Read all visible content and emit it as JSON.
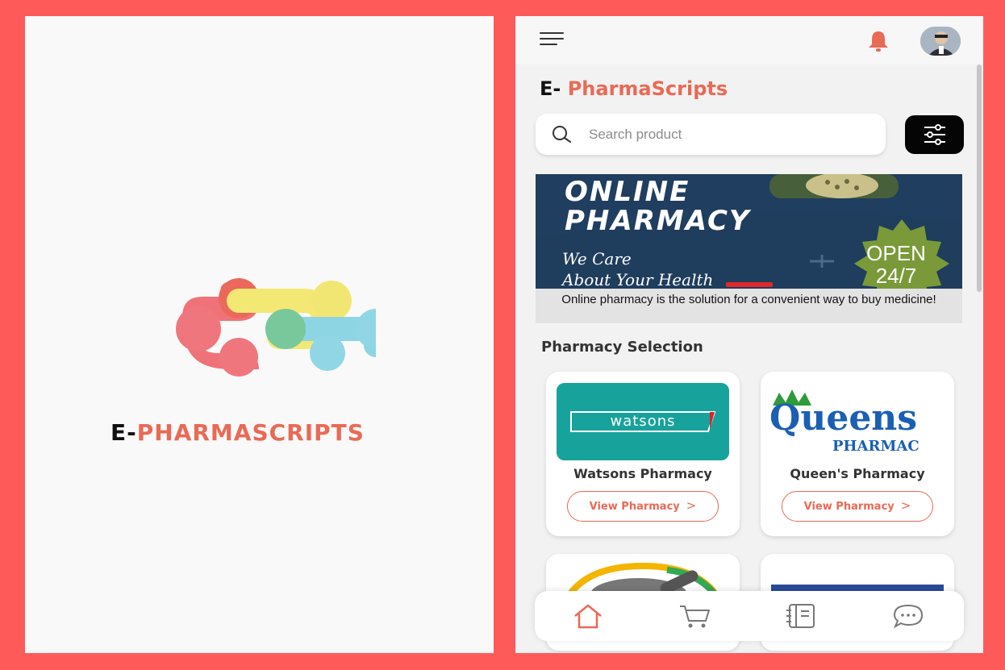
{
  "splash": {
    "brand_prefix": "E-",
    "brand_main": "PHARMASCRIPTS"
  },
  "app": {
    "title_prefix": "E- ",
    "title_main": "PharmaScripts",
    "search": {
      "placeholder": "Search product"
    },
    "banner": {
      "headline_line1": "ONLINE",
      "headline_line2": "PHARMACY",
      "tagline_line1": "We Care",
      "tagline_line2": "About Your Health",
      "badge_line1": "OPEN",
      "badge_line2": "24/7",
      "caption": "Online pharmacy is the solution for a convenient way to buy medicine!"
    },
    "section_title": "Pharmacy Selection",
    "pharmacies": [
      {
        "name": "Watsons Pharmacy",
        "logo_text": "watsons",
        "button_label": "View Pharmacy",
        "button_chevron": ">"
      },
      {
        "name": "Queen's Pharmacy",
        "logo_text": "Queens",
        "logo_sub": "PHARMAC",
        "button_label": "View Pharmacy",
        "button_chevron": ">"
      }
    ],
    "bottom_nav": [
      "home-icon",
      "cart-icon",
      "orders-icon",
      "chat-icon"
    ]
  },
  "colors": {
    "frame": "#ff5a5a",
    "accent": "#e96a55",
    "watsons_teal": "#17a39b",
    "queens_blue": "#1a5fb4"
  }
}
